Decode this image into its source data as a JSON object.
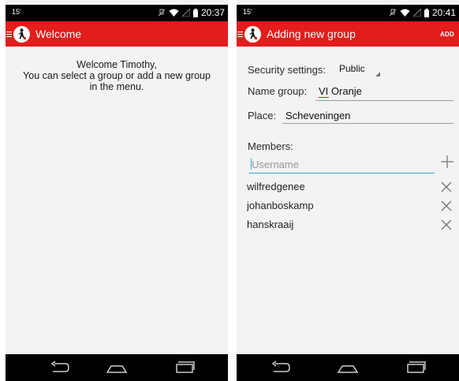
{
  "screens": [
    {
      "status": {
        "left": "15'",
        "time": "20:37"
      },
      "action_bar": {
        "title": "Welcome"
      },
      "content": {
        "lines": [
          "Welcome Timothy,",
          "You can select a group or add a new group",
          "in the menu."
        ]
      }
    },
    {
      "status": {
        "left": "15'",
        "time": "20:41"
      },
      "action_bar": {
        "title": "Adding new group",
        "action": "ADD"
      },
      "form": {
        "security_label": "Security settings:",
        "security_value": "Public",
        "name_label": "Name group:",
        "name_value": "VI Oranje",
        "place_label": "Place:",
        "place_value": "Scheveningen",
        "members_label": "Members:",
        "username_placeholder": "Username",
        "members": [
          "wilfredgenee",
          "johanboskamp",
          "hanskraaij"
        ]
      }
    }
  ],
  "colors": {
    "accent": "#e31c1c",
    "input_focus": "#33a7d8",
    "background": "#f3f3f3"
  },
  "icons": [
    "menu-icon",
    "app-logo-icon",
    "mute-icon",
    "wifi-icon",
    "signal-icon",
    "battery-icon",
    "plus-icon",
    "close-icon",
    "back-icon",
    "home-icon",
    "recents-icon"
  ]
}
